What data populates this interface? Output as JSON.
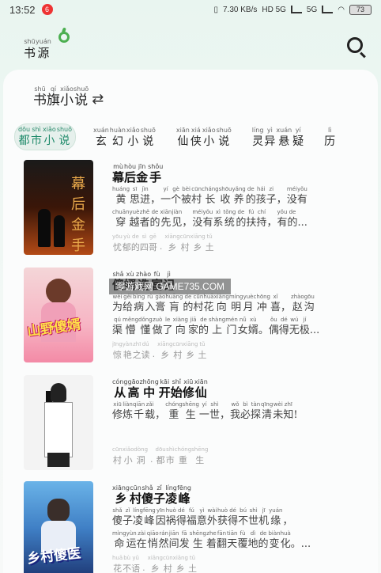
{
  "status_bar": {
    "time": "13:52",
    "app_badge": "6",
    "net_speed": "7.30 KB/s",
    "signal_1": "HD 5G",
    "signal_2": "5G",
    "battery": "73"
  },
  "header": {
    "title": {
      "chars": [
        "书",
        "源"
      ],
      "pinyin": [
        "shū",
        "yuán"
      ]
    }
  },
  "section": {
    "title": {
      "chars": [
        "书",
        "旗",
        "小",
        "说"
      ],
      "pinyin": [
        "shū",
        "qí",
        "xiǎo",
        "shuō"
      ]
    },
    "switch_symbol": "⇄"
  },
  "categories": [
    {
      "chars": [
        "都",
        "市",
        "小",
        "说"
      ],
      "pinyin": [
        "dōu",
        "shì",
        "xiǎo",
        "shuō"
      ],
      "active": true
    },
    {
      "chars": [
        "玄",
        "幻",
        "小",
        "说"
      ],
      "pinyin": [
        "xuán",
        "huàn",
        "xiǎo",
        "shuō"
      ],
      "active": false
    },
    {
      "chars": [
        "仙",
        "侠",
        "小",
        "说"
      ],
      "pinyin": [
        "xiān",
        "xiá",
        "xiǎo",
        "shuō"
      ],
      "active": false
    },
    {
      "chars": [
        "灵",
        "异",
        "悬",
        "疑"
      ],
      "pinyin": [
        "líng",
        "yì",
        "xuán",
        "yí"
      ],
      "active": false
    },
    {
      "chars": [
        "历"
      ],
      "pinyin": [
        "lì"
      ],
      "active": false
    }
  ],
  "books": [
    {
      "cover_text": "幕后金手",
      "title": {
        "chars": [
          "幕",
          "后",
          "金",
          "手"
        ],
        "pinyin": [
          "mù",
          "hòu",
          "jīn",
          "shǒu"
        ]
      },
      "desc1": {
        "chars": [
          "黄",
          "思",
          "进",
          "，",
          "一",
          "个",
          "被",
          "村",
          "长",
          "收",
          "养",
          "的",
          "孩",
          "子",
          "，",
          "没",
          "有"
        ],
        "pinyin": [
          "huáng",
          "sī",
          "jìn",
          "",
          "yí",
          "gè",
          "bèi",
          "cūn",
          "cháng",
          "shōu",
          "yǎng",
          "de",
          "hái",
          "zi",
          "",
          "méi",
          "yǒu"
        ]
      },
      "desc2": {
        "chars": [
          "穿",
          "越",
          "者",
          "的",
          "先",
          "见",
          "，",
          "没",
          "有",
          "系",
          "统",
          "的",
          "扶",
          "持",
          "，",
          "有",
          "的",
          "..."
        ],
        "pinyin": [
          "chuān",
          "yuè",
          "zhě",
          "de",
          "xiān",
          "jiàn",
          "",
          "méi",
          "yǒu",
          "xì",
          "tǒng",
          "de",
          "fú",
          "chí",
          "",
          "yǒu",
          "de",
          ""
        ]
      },
      "meta": {
        "author": {
          "chars": [
            "忧",
            "郁",
            "的",
            "四",
            "哥"
          ],
          "pinyin": [
            "yōu",
            "yù",
            "de",
            "sì",
            "gē"
          ]
        },
        "category": {
          "chars": [
            "乡",
            "村",
            "乡",
            "土"
          ],
          "pinyin": [
            "xiāng",
            "cūn",
            "xiāng",
            "tǔ"
          ]
        }
      }
    },
    {
      "cover_text": "山野傻婿",
      "title": {
        "chars": [
          "傻",
          "婿",
          "造",
          "富",
          "记"
        ],
        "pinyin": [
          "shǎ",
          "xù",
          "zhào",
          "fù",
          "jì"
        ]
      },
      "desc1": {
        "chars": [
          "为",
          "给",
          "病",
          "入",
          "膏",
          "肓",
          "的",
          "村",
          "花",
          "向",
          "明",
          "月",
          "冲",
          "喜",
          "，",
          "赵",
          "沟"
        ],
        "pinyin": [
          "wèi",
          "gěi",
          "bìng",
          "rù",
          "gāo",
          "huāng",
          "de",
          "cūn",
          "huā",
          "xiàng",
          "míng",
          "yuè",
          "chōng",
          "xǐ",
          "",
          "zhào",
          "gōu"
        ]
      },
      "desc2": {
        "chars": [
          "渠",
          "懵",
          "懂",
          "做",
          "了",
          "向",
          "家",
          "的",
          "上",
          "门",
          "女",
          "婿",
          "。",
          "偶",
          "得",
          "无",
          "极",
          "..."
        ],
        "pinyin": [
          "qú",
          "měng",
          "dǒng",
          "zuò",
          "le",
          "xiàng",
          "jiā",
          "de",
          "shàng",
          "mén",
          "nǚ",
          "xù",
          "",
          "ǒu",
          "dé",
          "wú",
          "jí",
          ""
        ]
      },
      "meta": {
        "author": {
          "chars": [
            "惊",
            "艳",
            "之",
            "读"
          ],
          "pinyin": [
            "jīng",
            "yàn",
            "zhī",
            "dú"
          ]
        },
        "category": {
          "chars": [
            "乡",
            "村",
            "乡",
            "土"
          ],
          "pinyin": [
            "xiāng",
            "cūn",
            "xiāng",
            "tǔ"
          ]
        }
      }
    },
    {
      "cover_text": "",
      "title": {
        "chars": [
          "从",
          "高",
          "中",
          "开",
          "始",
          "修",
          "仙"
        ],
        "pinyin": [
          "cóng",
          "gāo",
          "zhōng",
          "kāi",
          "shǐ",
          "xiū",
          "xiān"
        ]
      },
      "desc1": {
        "chars": [
          "修",
          "炼",
          "千",
          "载",
          "，",
          "重",
          "生",
          "一",
          "世",
          "，",
          "我",
          "必",
          "探",
          "清",
          "未",
          "知",
          "!"
        ],
        "pinyin": [
          "xiū",
          "liàn",
          "qiān",
          "zǎi",
          "",
          "chóng",
          "shēng",
          "yí",
          "shì",
          "",
          "wǒ",
          "bì",
          "tàn",
          "qīng",
          "wèi",
          "zhī",
          ""
        ]
      },
      "desc2": {
        "chars": [],
        "pinyin": []
      },
      "meta": {
        "author": {
          "chars": [
            "村",
            "小",
            "洞"
          ],
          "pinyin": [
            "cūn",
            "xiǎo",
            "dòng"
          ]
        },
        "category": {
          "chars": [
            "都",
            "市",
            "重",
            "生"
          ],
          "pinyin": [
            "dōu",
            "shì",
            "chóng",
            "shēng"
          ]
        }
      }
    },
    {
      "cover_text": "乡村傻医",
      "title": {
        "chars": [
          "乡",
          "村",
          "傻",
          "子",
          "凌",
          "峰"
        ],
        "pinyin": [
          "xiāng",
          "cūn",
          "shǎ",
          "zǐ",
          "líng",
          "fēng"
        ]
      },
      "desc1": {
        "chars": [
          "傻",
          "子",
          "凌",
          "峰",
          "因",
          "祸",
          "得",
          "福",
          "意",
          "外",
          "获",
          "得",
          "不",
          "世",
          "机",
          "缘",
          "，"
        ],
        "pinyin": [
          "shǎ",
          "zǐ",
          "líng",
          "fēng",
          "yīn",
          "huò",
          "dé",
          "fú",
          "yì",
          "wài",
          "huò",
          "dé",
          "bú",
          "shì",
          "jī",
          "yuán",
          ""
        ]
      },
      "desc2": {
        "chars": [
          "命",
          "运",
          "在",
          "悄",
          "然",
          "间",
          "发",
          "生",
          "着",
          "翻",
          "天",
          "覆",
          "地",
          "的",
          "变",
          "化",
          "。",
          "..."
        ],
        "pinyin": [
          "mìng",
          "yùn",
          "zài",
          "qiāo",
          "rán",
          "jiān",
          "fā",
          "shēng",
          "zhe",
          "fān",
          "tiān",
          "fù",
          "dì",
          "de",
          "biàn",
          "huà",
          "",
          ""
        ]
      },
      "meta": {
        "author": {
          "chars": [
            "花",
            "不",
            "语"
          ],
          "pinyin": [
            "huā",
            "bù",
            "yǔ"
          ]
        },
        "category": {
          "chars": [
            "乡",
            "村",
            "乡",
            "土"
          ],
          "pinyin": [
            "xiāng",
            "cūn",
            "xiāng",
            "tǔ"
          ]
        }
      }
    }
  ],
  "meta_separator": "·",
  "watermark": "零游戏网 GAME735.COM"
}
